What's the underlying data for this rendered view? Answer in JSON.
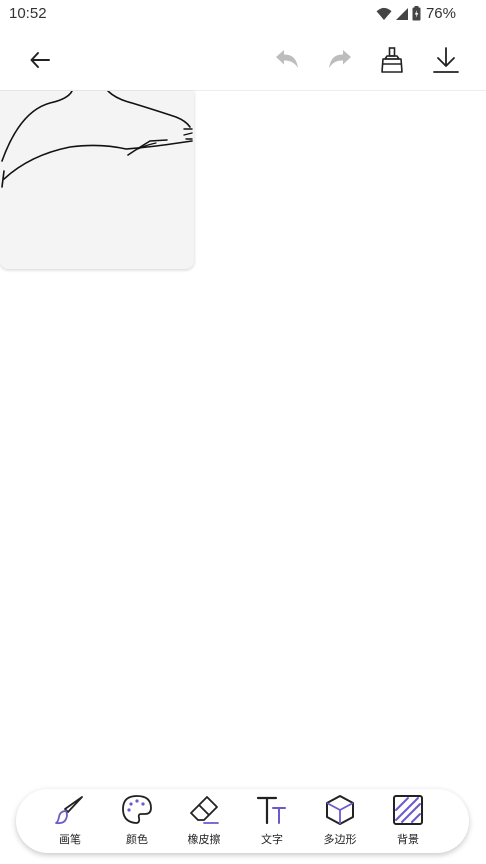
{
  "status_bar": {
    "time": "10:52",
    "battery_percent": "76%",
    "icons": [
      "wifi-icon",
      "cellular-signal-icon",
      "battery-icon"
    ]
  },
  "toolbar": {
    "icons": [
      "back-arrow-icon",
      "undo-icon",
      "redo-icon",
      "clear-broom-icon",
      "download-icon"
    ]
  },
  "bottom_tools": [
    {
      "label": "画笔",
      "icon": "brush-icon"
    },
    {
      "label": "颜色",
      "icon": "palette-icon"
    },
    {
      "label": "橡皮擦",
      "icon": "eraser-icon"
    },
    {
      "label": "文字",
      "icon": "text-icon"
    },
    {
      "label": "多边形",
      "icon": "polygon-cube-icon"
    },
    {
      "label": "背景",
      "icon": "background-hatch-icon"
    }
  ],
  "colors": {
    "accent": "#6a5acd",
    "icon_dark": "#222222",
    "icon_disabled": "#bdbdbd",
    "canvas_bg": "#f4f4f4"
  }
}
